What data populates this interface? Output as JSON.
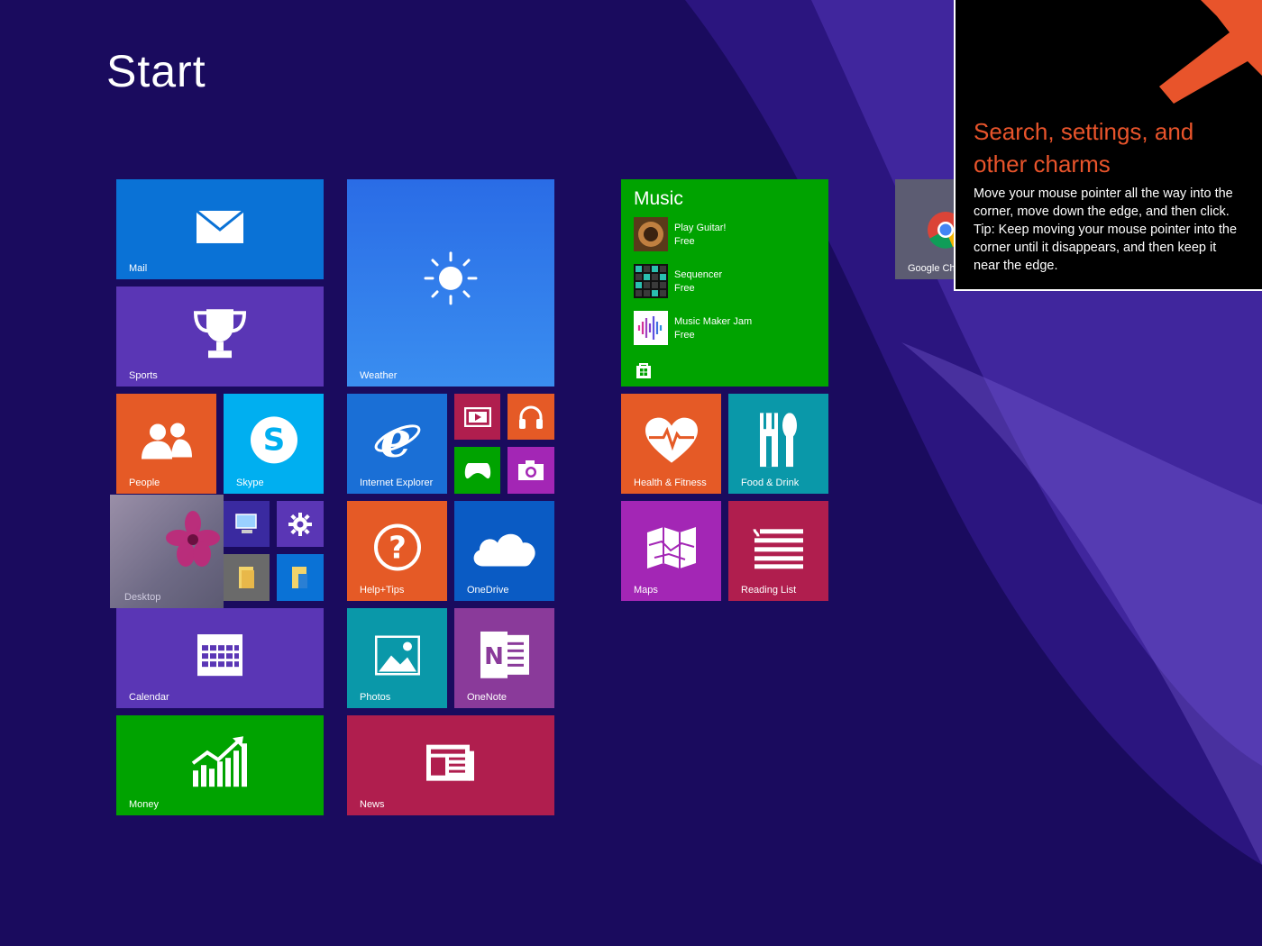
{
  "start": {
    "title": "Start"
  },
  "tiles": {
    "mail": "Mail",
    "sports": "Sports",
    "weather": "Weather",
    "people": "People",
    "skype": "Skype",
    "internet_explorer": "Internet Explorer",
    "desktop": "Desktop",
    "help_tips": "Help+Tips",
    "onedrive": "OneDrive",
    "calendar": "Calendar",
    "photos": "Photos",
    "onenote": "OneNote",
    "money": "Money",
    "news": "News",
    "health_fitness": "Health & Fitness",
    "food_drink": "Food & Drink",
    "maps": "Maps",
    "reading_list": "Reading List",
    "google_chrome": "Google Ch"
  },
  "music": {
    "title": "Music",
    "items": [
      {
        "name": "Play Guitar!",
        "price": "Free"
      },
      {
        "name": "Sequencer",
        "price": "Free"
      },
      {
        "name": "Music Maker Jam",
        "price": "Free"
      }
    ]
  },
  "tip": {
    "heading": "Search, settings, and other charms",
    "body": "Move your mouse pointer all the way into the corner, move down the edge, and then click. Tip: Keep moving your mouse pointer into the corner until it disappears, and then keep it near the edge."
  },
  "colors": {
    "background": "#1a0b5e",
    "blue": "#0a72d6",
    "purple": "#5a36b5",
    "orange": "#e55a26",
    "green": "#00a300",
    "crimson": "#b01e4e",
    "teal": "#0a98a9",
    "magenta": "#a326b5",
    "tip_accent": "#e8542b"
  }
}
